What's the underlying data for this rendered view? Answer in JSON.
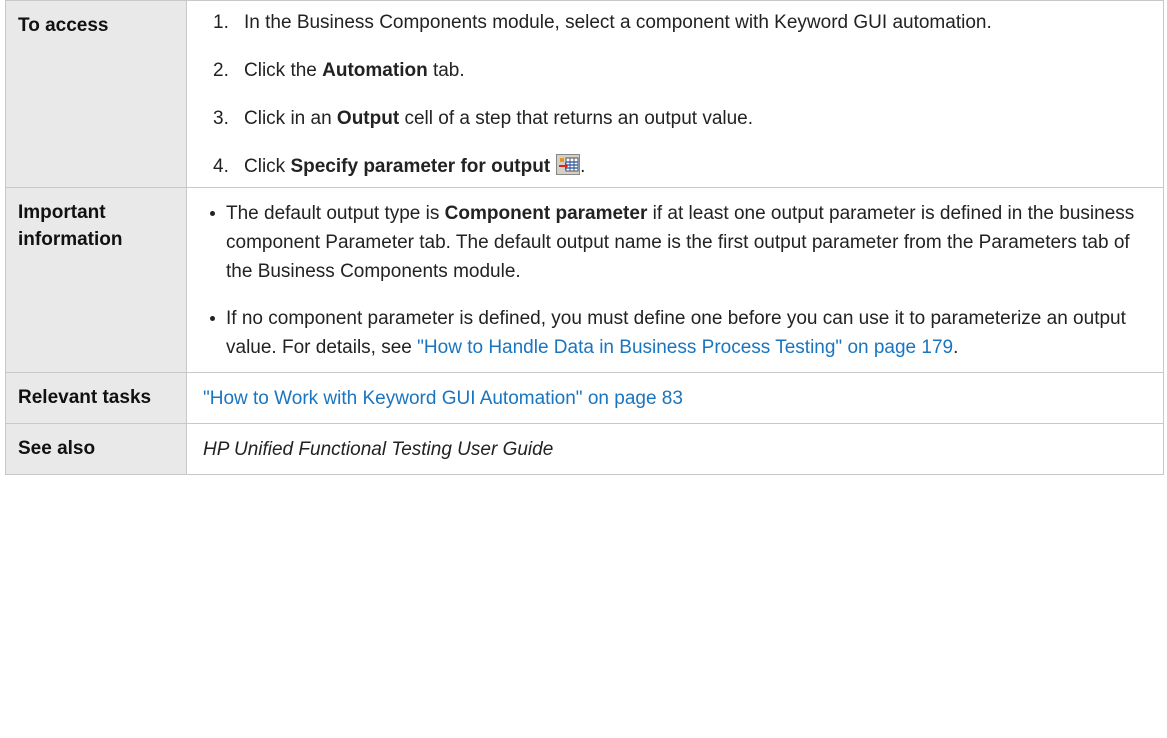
{
  "rows": {
    "access": {
      "header": "To access",
      "steps": [
        {
          "num": "1.",
          "text": "In the Business Components module, select a component with Keyword GUI automation."
        },
        {
          "num": "2.",
          "pre": "Click the ",
          "bold": "Automation",
          "post": " tab."
        },
        {
          "num": "3.",
          "pre": "Click in an ",
          "bold": "Output",
          "post": " cell of a step that returns an output value."
        },
        {
          "num": "4.",
          "pre": "Click ",
          "bold": "Specify parameter for output",
          "post": ".",
          "icon": "specify-parameter-icon"
        }
      ]
    },
    "important": {
      "header": "Important information",
      "bullets": [
        {
          "pre": "The default output type is ",
          "bold": "Component parameter",
          "post": " if at least one output parameter is defined in the business component Parameter tab. The default output name is the first output parameter from the Parameters tab of the Business Components module."
        },
        {
          "pre": "If no component parameter is defined, you must define one before you can use it to parameterize an output value. For details, see ",
          "link": "\"How to Handle Data in Business Process Testing\" on page 179",
          "post": "."
        }
      ]
    },
    "tasks": {
      "header": "Relevant tasks",
      "link": "\"How to Work with Keyword GUI Automation\" on page 83"
    },
    "see_also": {
      "header": "See also",
      "text": "HP Unified Functional Testing User Guide"
    }
  },
  "colors": {
    "link": "#1a75c0",
    "header_bg": "#e9e9e9",
    "border": "#c8c8c8"
  }
}
